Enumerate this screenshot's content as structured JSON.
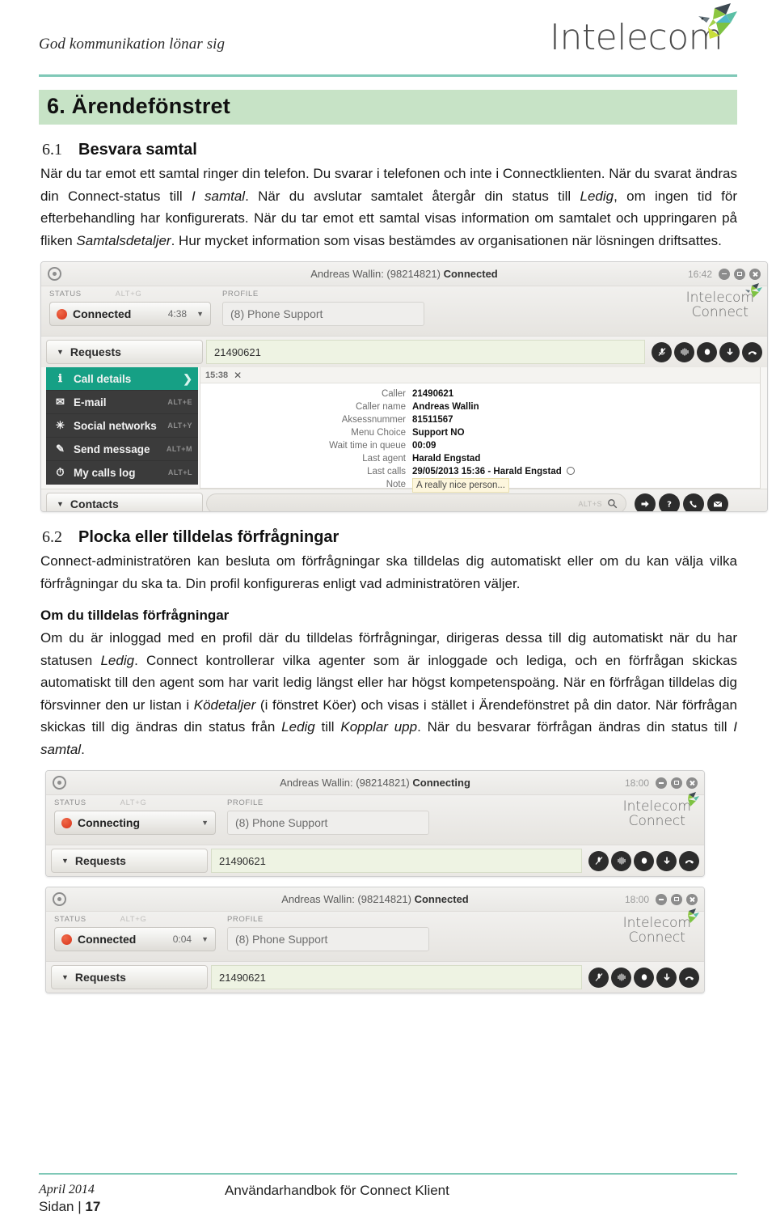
{
  "header": {
    "tagline": "God kommunikation lönar sig",
    "logo_word": "Intelecom",
    "logo_bird_icon": "bird-logo-icon",
    "rule_color": "#7fc8b7"
  },
  "chapter": {
    "band_color": "#c7e3c6",
    "title": "6. Ärendefönstret"
  },
  "section_61": {
    "number": "6.1",
    "title": "Besvara samtal",
    "paragraph_parts": [
      {
        "t": "När du tar emot ett samtal ringer din telefon. Du svarar i telefonen och inte i Connectklienten. När du svarat ändras din Connect-status till ",
        "s": "n"
      },
      {
        "t": "I samtal",
        "s": "i"
      },
      {
        "t": ". När du avslutar samtalet återgår din status till ",
        "s": "n"
      },
      {
        "t": "Ledig",
        "s": "i"
      },
      {
        "t": ", om ingen tid för efterbehandling har konfigurerats. När du tar emot ett samtal visas information om samtalet och uppringaren på fliken ",
        "s": "n"
      },
      {
        "t": "Samtalsdetaljer",
        "s": "i"
      },
      {
        "t": ". Hur mycket information som visas bestämdes av organisationen när lösningen driftsattes.",
        "s": "n"
      }
    ]
  },
  "screenshot_1": {
    "titlebar": {
      "name": "Andreas Wallin: (98214821)",
      "state": "Connected",
      "clock": "16:42"
    },
    "status_label": "STATUS",
    "status_alt": "ALT+G",
    "profile_label": "PROFILE",
    "status_value": "Connected",
    "status_timer": "4:38",
    "profile_value": "(8) Phone Support",
    "brand_line1": "Intelecom",
    "brand_line2": "Connect",
    "requests_tab": "Requests",
    "requests_value": "21490621",
    "call_buttons": [
      "mute-icon",
      "record-icon",
      "hold-icon",
      "transfer-down-icon",
      "hangup-icon"
    ],
    "tab_time": "15:38",
    "menu": [
      {
        "label": "Call details",
        "icon": "info-icon",
        "alt": "",
        "active": true
      },
      {
        "label": "E-mail",
        "icon": "envelope-icon",
        "alt": "ALT+E",
        "active": false
      },
      {
        "label": "Social networks",
        "icon": "network-icon",
        "alt": "ALT+Y",
        "active": false
      },
      {
        "label": "Send message",
        "icon": "pen-icon",
        "alt": "ALT+M",
        "active": false
      },
      {
        "label": "My calls log",
        "icon": "clock-icon",
        "alt": "ALT+L",
        "active": false
      }
    ],
    "details": [
      {
        "key": "Caller",
        "value": "21490621",
        "note": false,
        "circle": false
      },
      {
        "key": "Caller name",
        "value": "Andreas Wallin",
        "note": false,
        "circle": false
      },
      {
        "key": "Aksessnummer",
        "value": "81511567",
        "note": false,
        "circle": false
      },
      {
        "key": "Menu Choice",
        "value": "Support NO",
        "note": false,
        "circle": false
      },
      {
        "key": "Wait time in queue",
        "value": "00:09",
        "note": false,
        "circle": false
      },
      {
        "key": "Last agent",
        "value": "Harald Engstad",
        "note": false,
        "circle": false
      },
      {
        "key": "Last calls",
        "value": "29/05/2013 15:36 - Harald Engstad",
        "note": false,
        "circle": true
      },
      {
        "key": "Note",
        "value": "A really nice person...",
        "note": true,
        "circle": false
      }
    ],
    "contacts_tab": "Contacts",
    "search_alt": "ALT+S",
    "bottom_buttons": [
      "forward-icon",
      "help-icon",
      "call-icon",
      "mail-icon"
    ]
  },
  "section_62": {
    "number": "6.2",
    "title": "Plocka eller tilldelas förfrågningar",
    "paragraph": "Connect-administratören kan besluta om förfrågningar ska tilldelas dig automatiskt eller om du kan välja vilka förfrågningar du ska ta. Din profil konfigureras enligt vad administratören väljer."
  },
  "subsection": {
    "title": "Om du tilldelas förfrågningar",
    "paragraph_parts": [
      {
        "t": "Om du är inloggad med en profil där du tilldelas förfrågningar, dirigeras dessa till dig automatiskt när du har statusen ",
        "s": "n"
      },
      {
        "t": "Ledig",
        "s": "i"
      },
      {
        "t": ". Connect kontrollerar vilka agenter som är inloggade och lediga, och en förfrågan skickas automatiskt till den agent som har varit ledig längst eller har högst kompetenspoäng. När en förfrågan tilldelas dig försvinner den ur listan i ",
        "s": "n"
      },
      {
        "t": "Ködetaljer",
        "s": "i"
      },
      {
        "t": " (i fönstret Köer) och visas i stället i Ärendefönstret på din dator. När förfrågan skickas till dig ändras din status från ",
        "s": "n"
      },
      {
        "t": "Ledig",
        "s": "i"
      },
      {
        "t": " till ",
        "s": "n"
      },
      {
        "t": "Kopplar upp",
        "s": "i"
      },
      {
        "t": ". När du besvarar förfrågan ändras din status till ",
        "s": "n"
      },
      {
        "t": "I samtal",
        "s": "i"
      },
      {
        "t": ".",
        "s": "n"
      }
    ]
  },
  "screenshot_2": {
    "titlebar": {
      "name": "Andreas Wallin: (98214821)",
      "state": "Connecting",
      "clock": "18:00"
    },
    "status_label": "STATUS",
    "status_alt": "ALT+G",
    "profile_label": "PROFILE",
    "status_value": "Connecting",
    "status_timer": "",
    "profile_value": "(8) Phone Support",
    "brand_line1": "Intelecom",
    "brand_line2": "Connect",
    "requests_tab": "Requests",
    "requests_value": "21490621"
  },
  "screenshot_3": {
    "titlebar": {
      "name": "Andreas Wallin: (98214821)",
      "state": "Connected",
      "clock": "18:00"
    },
    "status_label": "STATUS",
    "status_alt": "ALT+G",
    "profile_label": "PROFILE",
    "status_value": "Connected",
    "status_timer": "0:04",
    "profile_value": "(8) Phone Support",
    "brand_line1": "Intelecom",
    "brand_line2": "Connect",
    "requests_tab": "Requests",
    "requests_value": "21490621"
  },
  "footer": {
    "date": "April 2014",
    "page_label": "Sidan |",
    "page_number": "17",
    "center": "Användarhandbok för Connect Klient",
    "rule_color": "#7fc8b7"
  }
}
